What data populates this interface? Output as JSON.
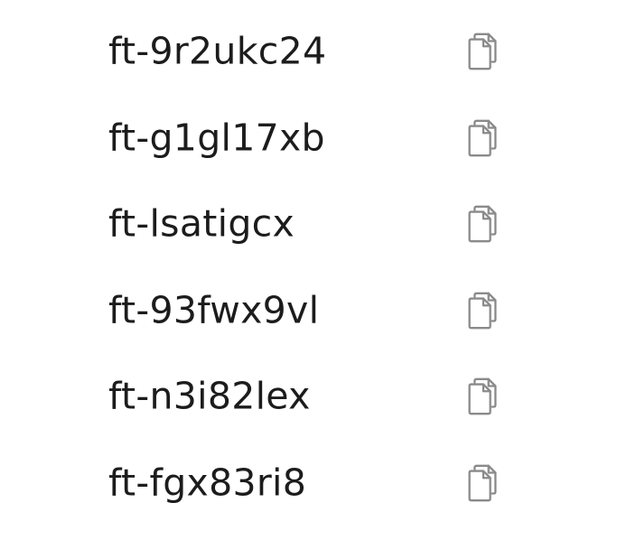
{
  "items": [
    {
      "id_text": "ft-9r2ukc24",
      "icon": "copy-icon"
    },
    {
      "id_text": "ft-g1gl17xb",
      "icon": "copy-icon"
    },
    {
      "id_text": "ft-lsatigcx",
      "icon": "copy-icon"
    },
    {
      "id_text": "ft-93fwx9vl",
      "icon": "copy-icon"
    },
    {
      "id_text": "ft-n3i82lex",
      "icon": "copy-icon"
    },
    {
      "id_text": "ft-fgx83ri8",
      "icon": "copy-icon"
    }
  ],
  "colors": {
    "text": "#1c1c1c",
    "icon": "#8a8a8a",
    "background": "#ffffff"
  }
}
